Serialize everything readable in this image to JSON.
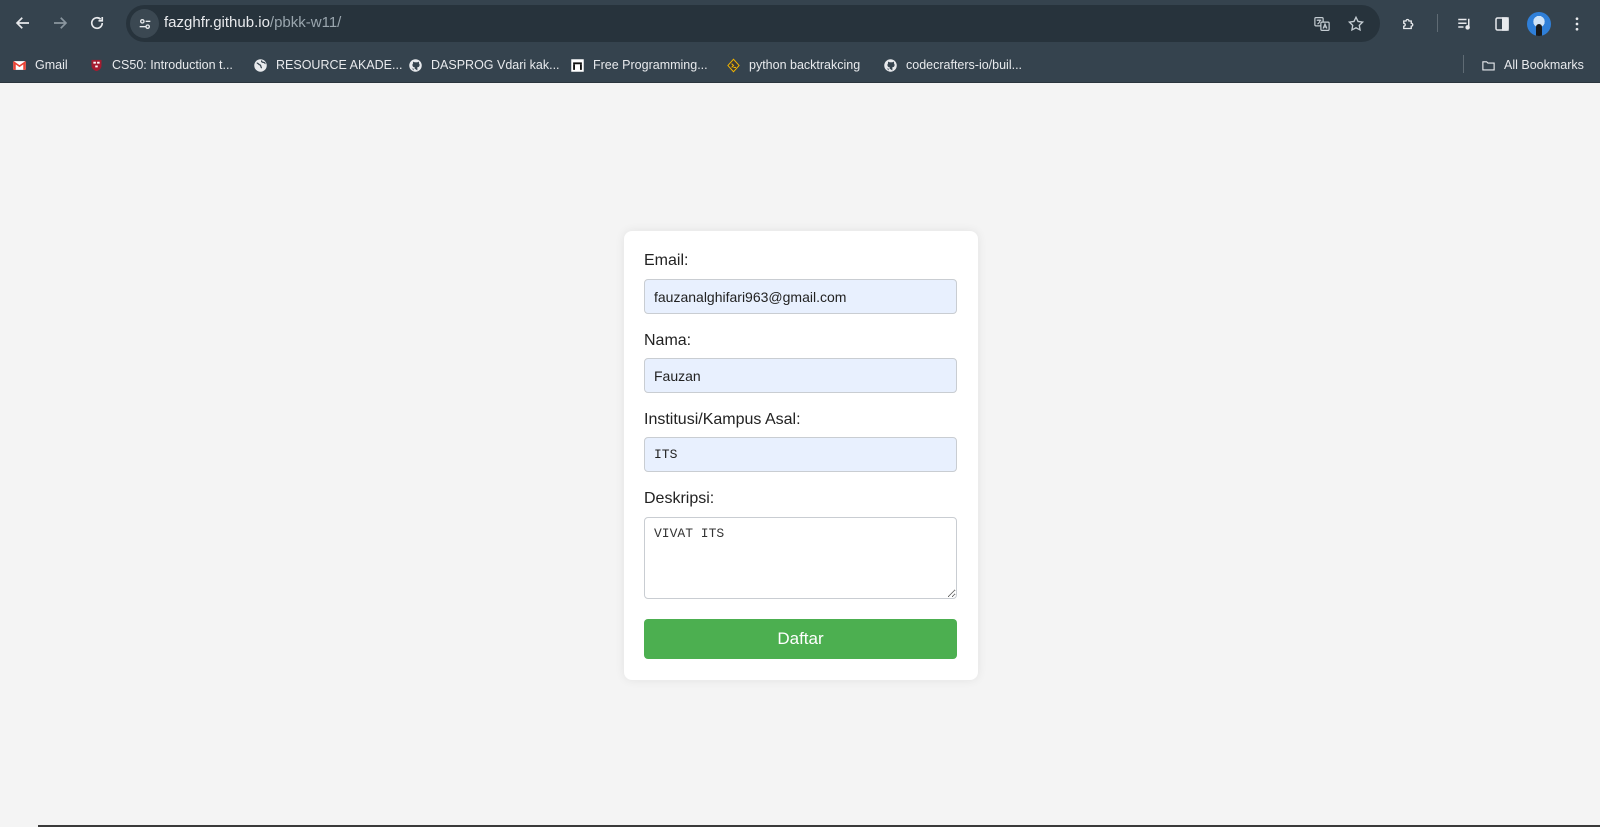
{
  "browser": {
    "url_host": "fazghfr.github.io",
    "url_path": "/pbkk-w11/",
    "icons": {
      "back": "arrow-left-icon",
      "forward": "arrow-right-icon",
      "reload": "reload-icon",
      "site_info": "tune-icon",
      "translate": "translate-icon",
      "bookmark_star": "star-icon",
      "extensions": "puzzle-icon",
      "media": "playlist-icon",
      "side_panel": "side-panel-icon",
      "profile": "avatar",
      "menu": "kebab-menu-icon"
    }
  },
  "bookmarks": {
    "items": [
      {
        "label": "Gmail",
        "icon": "gmail-icon"
      },
      {
        "label": "CS50: Introduction t...",
        "icon": "harvard-shield-icon"
      },
      {
        "label": "RESOURCE AKADE...",
        "icon": "globe-icon"
      },
      {
        "label": "DASPROG Vdari kak...",
        "icon": "github-icon"
      },
      {
        "label": "Free Programming...",
        "icon": "bookmark-site-icon"
      },
      {
        "label": "python backtrakcing",
        "icon": "python-diamond-icon"
      },
      {
        "label": "codecrafters-io/buil...",
        "icon": "github-icon"
      }
    ],
    "all_bookmarks_label": "All Bookmarks"
  },
  "form": {
    "email_label": "Email:",
    "email_value": "fauzanalghifari963@gmail.com",
    "nama_label": "Nama:",
    "nama_value": "Fauzan",
    "institusi_label": "Institusi/Kampus Asal:",
    "institusi_value": "ITS",
    "deskripsi_label": "Deskripsi:",
    "deskripsi_value": "VIVAT ITS",
    "submit_label": "Daftar"
  },
  "colors": {
    "chrome_bg": "#35434e",
    "page_bg": "#f4f4f4",
    "autofill_bg": "#e8f0fe",
    "submit_bg": "#4caf50"
  }
}
